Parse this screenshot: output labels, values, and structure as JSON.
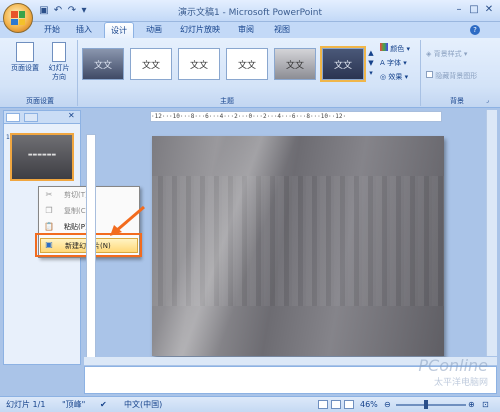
{
  "titlebar": {
    "title": "演示文稿1 - Microsoft PowerPoint",
    "minimize": "–",
    "maximize": "□",
    "close": "✕"
  },
  "quick_access": {
    "save_icon": "💾",
    "undo_icon": "↶",
    "redo_icon": "↷",
    "customize_icon": "▾"
  },
  "tabs": [
    "开始",
    "插入",
    "设计",
    "动画",
    "幻灯片放映",
    "审阅",
    "视图"
  ],
  "active_tab": "设计",
  "ribbon": {
    "page_setup": {
      "page_setup_label": "页面设置",
      "orientation_label": "幻灯片\n方向",
      "group_label": "页面设置"
    },
    "themes": {
      "thumb_text": "文文",
      "group_label": "主题"
    },
    "theme_options": {
      "colors": "颜色",
      "fonts": "字体",
      "effects": "效果"
    },
    "background": {
      "styles": "背景样式",
      "hide_graphics": "隐藏背景图形",
      "group_label": "背景"
    }
  },
  "left_panel": {
    "close": "✕"
  },
  "context_menu": {
    "cut": "剪切(T)",
    "copy": "复制(C)",
    "paste": "粘贴(P)",
    "new_slide": "新建幻灯片(N)"
  },
  "ruler_h": "·12···10···8···6···4···2···0···2···4···6···8···10··12·",
  "statusbar": {
    "slide_info": "幻灯片 1/1",
    "theme_name": "\"顶峰\"",
    "language": "中文(中国)",
    "zoom": "46%"
  },
  "watermark": {
    "brand": "PConline",
    "sub": "太平洋电脑网"
  },
  "colors": {
    "accent": "#f26b1e",
    "ribbon_bg": "#d3e3f8",
    "frame": "#aac4e8"
  }
}
